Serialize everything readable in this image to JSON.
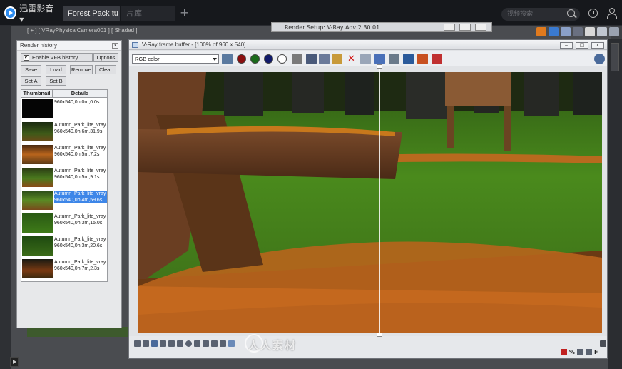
{
  "player": {
    "logo_label": "迅雷影音 ▾",
    "tabs": [
      {
        "label": "Forest Pack tu",
        "active": true
      },
      {
        "label": "片库",
        "active": false
      }
    ],
    "tab_close": "×",
    "new_tab": "+",
    "search_placeholder": "视频搜索"
  },
  "max": {
    "viewport_label": "[ + ] [ VRayPhysicalCamera001 ] [ Shaded ]",
    "render_setup_title": "Render Setup: V-Ray Adv 2.30.01"
  },
  "render_history": {
    "title": "Render history",
    "close": "x",
    "enable_label": "Enable VFB history",
    "enable_checked": "✔",
    "buttons": {
      "options": "Options",
      "save": "Save",
      "load": "Load",
      "remove": "Remove",
      "clear": "Clear",
      "set_a": "Set A",
      "set_b": "Set B"
    },
    "columns": {
      "thumbnail": "Thumbnail",
      "details": "Details"
    },
    "rows": [
      {
        "name": "",
        "details": "960x540,0h,0m,0.0s",
        "selected": false
      },
      {
        "name": "Autumn_Park_lite_vray",
        "details": "960x540,0h,6m,31.9s",
        "selected": false
      },
      {
        "name": "Autumn_Park_lite_vray",
        "details": "960x540,0h,5m,7.2s",
        "selected": false
      },
      {
        "name": "Autumn_Park_lite_vray",
        "details": "960x540,0h,5m,9.1s",
        "selected": false
      },
      {
        "name": "Autumn_Park_lite_vray",
        "details": "960x540,0h,4m,59.6s",
        "selected": true
      },
      {
        "name": "Autumn_Park_lite_vray",
        "details": "960x540,0h,3m,15.0s",
        "selected": false
      },
      {
        "name": "Autumn_Park_lite_vray",
        "details": "960x540,0h,3m,20.6s",
        "selected": false
      },
      {
        "name": "Autumn_Park_lite_vray",
        "details": "960x540,0h,7m,2.3s",
        "selected": false
      }
    ]
  },
  "vfb": {
    "title": "V-Ray frame buffer - [100% of 960 x 540]",
    "window_buttons": {
      "minimize": "‒",
      "maximize": "□",
      "close": "x"
    },
    "channel": "RGB color",
    "footer_icons": [
      "%",
      "F"
    ]
  },
  "watermark": "人人素材"
}
